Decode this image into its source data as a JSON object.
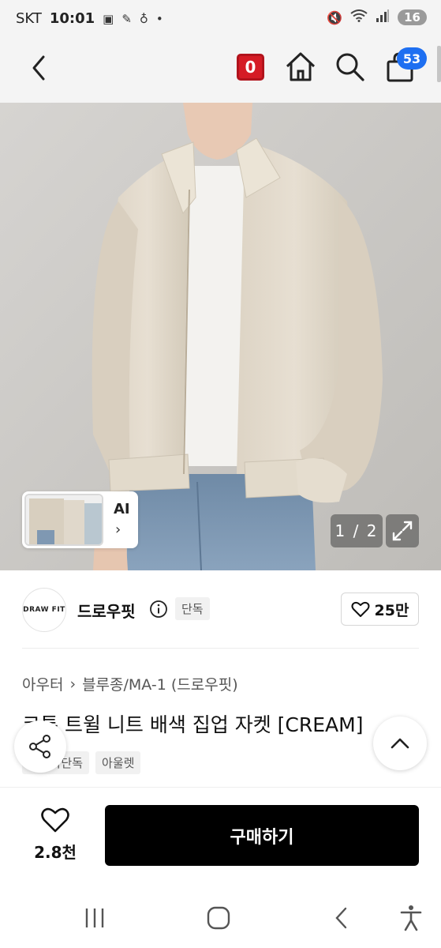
{
  "status_bar": {
    "carrier": "SKT",
    "time": "10:01",
    "battery": "16"
  },
  "header": {
    "points_badge": "0",
    "cart_count": "53"
  },
  "gallery": {
    "thumb_label": "AI",
    "page_indicator": "1 / 2"
  },
  "brand": {
    "logo_text": "DRAW FIT",
    "name": "드로우핏",
    "exclusive_tag": "단독",
    "likes": "25만"
  },
  "product": {
    "breadcrumb": [
      "아우터",
      "블루종/MA-1 (드로우핏)"
    ],
    "title": "코튼 트윌 니트 배색 집업 자켓 [CREAM]",
    "tags": [
      "무신사단독",
      "아울렛"
    ]
  },
  "purchase_bar": {
    "wish_count": "2.8천",
    "buy_label": "구매하기"
  },
  "colors": {
    "badge_red": "#d51b25",
    "cart_blue": "#1e6ff1",
    "buy_button": "#000000"
  },
  "icons": [
    "back-icon",
    "home-icon",
    "search-icon",
    "cart-icon",
    "expand-icon",
    "info-icon",
    "heart-icon",
    "share-icon",
    "chevron-up-icon",
    "recent-apps-icon",
    "home-nav-icon",
    "back-nav-icon",
    "accessibility-icon"
  ]
}
